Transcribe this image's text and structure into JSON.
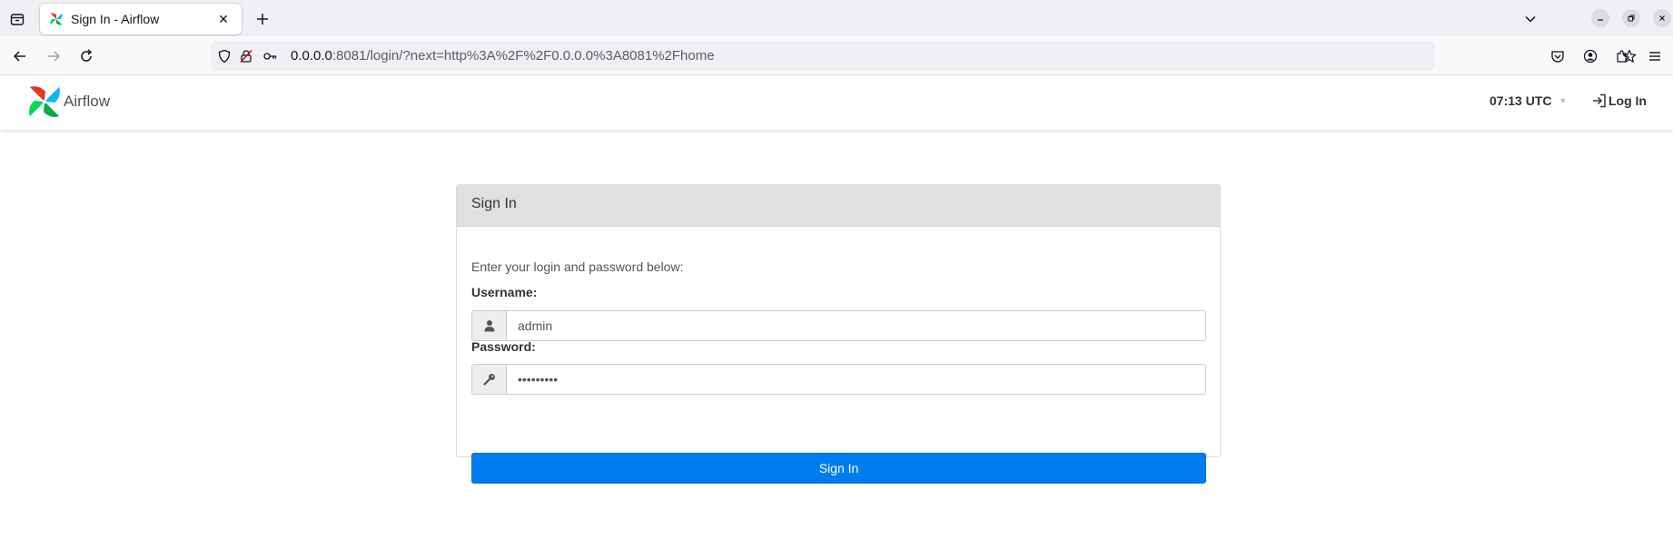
{
  "browser": {
    "tab": {
      "title": "Sign In - Airflow",
      "close_glyph": "✕"
    },
    "new_tab_glyph": "+",
    "url": {
      "host": "0.0.0.0",
      "rest": ":8081/login/?next=http%3A%2F%2F0.0.0.0%3A8081%2Fhome"
    }
  },
  "app": {
    "brand": "Airflow",
    "clock": "07:13 UTC",
    "login_link": "Log In",
    "colors": {
      "accent": "#017cee",
      "logo_red": "#e43921",
      "logo_blue": "#00ad46",
      "logo_teal": "#04d659",
      "logo_navy": "#0cb6ff"
    }
  },
  "signin": {
    "heading": "Sign In",
    "instructions": "Enter your login and password below:",
    "username_label": "Username:",
    "username_value": "admin",
    "password_label": "Password:",
    "password_value": "•••••••••",
    "submit_label": "Sign In"
  },
  "icons": {
    "tab_list": "tab-list-icon",
    "favicon": "airflow-logo-icon",
    "back": "back-arrow-icon",
    "forward": "forward-arrow-icon",
    "reload": "reload-icon",
    "shield": "shield-icon",
    "no_lock": "insecure-lock-icon",
    "key": "key-icon",
    "star": "bookmark-star-icon",
    "pocket": "pocket-icon",
    "account": "account-icon",
    "extensions": "extensions-icon",
    "menu": "hamburger-menu-icon",
    "user": "user-icon",
    "password_key": "key-icon",
    "login": "sign-in-icon"
  }
}
